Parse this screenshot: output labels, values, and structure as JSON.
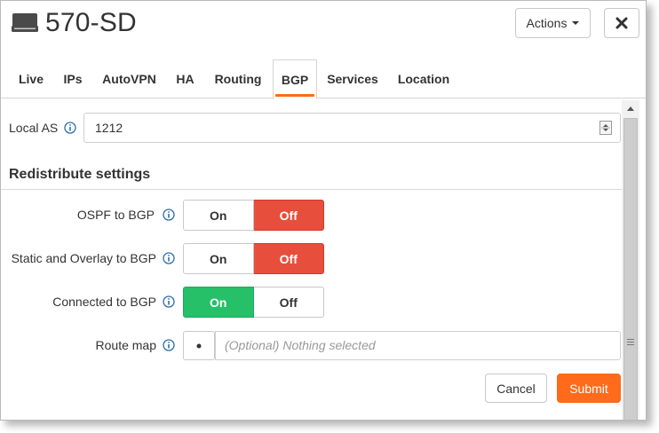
{
  "header": {
    "title": "570-SD",
    "actions_label": "Actions",
    "device_icon": "device-icon",
    "close_icon": "close-icon"
  },
  "tabs": [
    {
      "label": "Live",
      "active": false
    },
    {
      "label": "IPs",
      "active": false
    },
    {
      "label": "AutoVPN",
      "active": false
    },
    {
      "label": "HA",
      "active": false
    },
    {
      "label": "Routing",
      "active": false
    },
    {
      "label": "BGP",
      "active": true
    },
    {
      "label": "Services",
      "active": false
    },
    {
      "label": "Location",
      "active": false
    }
  ],
  "form": {
    "local_as": {
      "label": "Local AS",
      "value": "1212"
    },
    "section_title": "Redistribute settings",
    "ospf_to_bgp": {
      "label": "OSPF to BGP",
      "on_label": "On",
      "off_label": "Off",
      "selected": "Off"
    },
    "static_overlay_to_bgp": {
      "label": "Static and Overlay to BGP",
      "on_label": "On",
      "off_label": "Off",
      "selected": "Off"
    },
    "connected_to_bgp": {
      "label": "Connected to BGP",
      "on_label": "On",
      "off_label": "Off",
      "selected": "On"
    },
    "route_map": {
      "label": "Route map",
      "placeholder": "(Optional) Nothing selected"
    }
  },
  "footer": {
    "cancel_label": "Cancel",
    "submit_label": "Submit"
  },
  "colors": {
    "accent": "#ff6b1a",
    "off_active": "#e84e3c",
    "on_active": "#26c069",
    "info_icon": "#2b6ea8"
  }
}
